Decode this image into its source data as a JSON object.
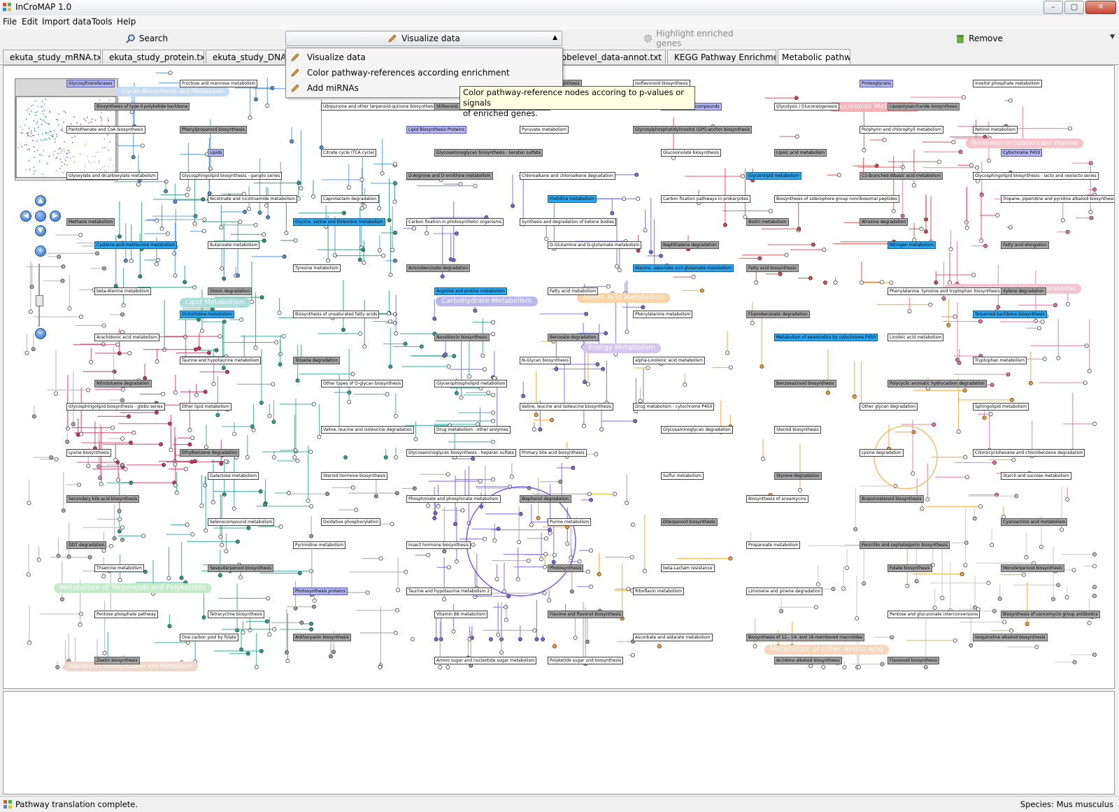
{
  "window": {
    "title": "InCroMAP 1.0",
    "min_glyph": "–",
    "max_glyph": "▢",
    "close_glyph": "✕"
  },
  "menu": {
    "items": [
      "File",
      "Edit",
      "Import data",
      "Tools",
      "Help"
    ]
  },
  "toolbar": {
    "search_label": "Search",
    "visualize_label": "Visualize data",
    "highlight_label": "Highlight enriched genes",
    "remove_label": "Remove"
  },
  "tabs": [
    "ekuta_study_mRNA.txt",
    "ekuta_study_protein.txt",
    "ekuta_study_DNA",
    "m_probelevel_data-annot.txt",
    "KEGG Pathway Enrichment",
    "Metabolic pathways"
  ],
  "dropdown": {
    "items": [
      "Visualize data",
      "Color pathway-references according enrichment",
      "Add miRNAs"
    ]
  },
  "tooltip": {
    "line1": "Color pathway-reference nodes accoring to p-values or signals",
    "line2": "of enriched genes."
  },
  "map": {
    "regions": [
      {
        "text": "Nucleotide Metabolism",
        "color": "#f7b0b8"
      },
      {
        "text": "Metabolism of Cofactors and Vitamins",
        "color": "#f7c4cc"
      },
      {
        "text": "Biosynthesis of Other Secondary Metabolites",
        "color": "#f3c4d0"
      },
      {
        "text": "Lipid Metabolism",
        "color": "#a9ddd8"
      },
      {
        "text": "Carbohydrate Metabolism",
        "color": "#b8b8ee"
      },
      {
        "text": "Amino Acid Metabolism",
        "color": "#f8d4a8"
      },
      {
        "text": "Energy Metabolism",
        "color": "#d4c4f0"
      },
      {
        "text": "Metabolism of Terpenoids and Polyketides",
        "color": "#c4ecc8"
      },
      {
        "text": "Metabolism of Other Amino Acid",
        "color": "#f8d4b8"
      },
      {
        "text": "Glycan Biosynthesis and Metabolism",
        "color": "#c4dcf4"
      },
      {
        "text": "Xenobiotics Biodegradation and Metabolism",
        "color": "#eed8cc"
      }
    ],
    "labels": [
      {
        "text": "Glycosyltransferases",
        "kind": "lav"
      },
      {
        "text": "Proteoglycans",
        "kind": "lav"
      },
      {
        "text": "Phytochemical compounds",
        "kind": "lav"
      },
      {
        "text": "Lipid Biosynthesis Proteins",
        "kind": "lav"
      },
      {
        "text": "Lipids",
        "kind": "lav"
      },
      {
        "text": "Cytochrome P450",
        "kind": "lav"
      },
      {
        "text": "Glycerolipid metabolism",
        "kind": "blue"
      },
      {
        "text": "Histidine metabolism",
        "kind": "blue"
      },
      {
        "text": "Glycine, serine and threonine metabolism",
        "kind": "blue"
      },
      {
        "text": "Cysteine and methionine metabolism",
        "kind": "blue"
      },
      {
        "text": "Nitrogen metabolism",
        "kind": "blue"
      },
      {
        "text": "Alanine, aspartate and glutamate metabolism",
        "kind": "blue"
      },
      {
        "text": "Arginine and proline metabolism",
        "kind": "blue"
      },
      {
        "text": "Glutathione metabolism",
        "kind": "blue"
      },
      {
        "text": "Terpenoid backbone biosynthesis",
        "kind": "blue"
      },
      {
        "text": "Metabolism of xenobiotics by cytochrome P450",
        "kind": "blue"
      },
      {
        "text": "N-Glycan biosynthesis",
        "kind": "white"
      },
      {
        "text": "Other types of O-glycan biosynthesis",
        "kind": "white"
      },
      {
        "text": "Glycosphingolipid biosynthesis - globo series",
        "kind": "white"
      },
      {
        "text": "Other glycan degradation",
        "kind": "white"
      },
      {
        "text": "Glycosaminoglycan degradation",
        "kind": "white"
      },
      {
        "text": "Glycosaminoglycan biosynthesis - heparan sulfate",
        "kind": "white"
      },
      {
        "text": "Galactose metabolism",
        "kind": "white"
      },
      {
        "text": "Starch and sucrose metabolism",
        "kind": "white"
      },
      {
        "text": "Biosynthesis of ansamycins",
        "kind": "white"
      },
      {
        "text": "Purine metabolism",
        "kind": "white"
      },
      {
        "text": "Pyrimidine metabolism",
        "kind": "white"
      },
      {
        "text": "Thiamine metabolism",
        "kind": "white"
      },
      {
        "text": "Folate biosynthesis",
        "kind": "gray"
      },
      {
        "text": "Riboflavin metabolism",
        "kind": "white"
      },
      {
        "text": "Vitamin B6 metabolism",
        "kind": "white"
      },
      {
        "text": "One carbon pool by folate",
        "kind": "white"
      },
      {
        "text": "Isoquinoline alkaloid biosynthesis",
        "kind": "gray"
      },
      {
        "text": "Acridone alkaloid biosynthesis",
        "kind": "gray"
      },
      {
        "text": "Indole alkaloid biosynthesis",
        "kind": "gray"
      },
      {
        "text": "Ubiquinone and other terpenoid-quinone biosynthesis",
        "kind": "white"
      },
      {
        "text": "Pantothenate and CoA biosynthesis",
        "kind": "white"
      },
      {
        "text": "Porphyrin and chlorophyll metabolism",
        "kind": "white"
      },
      {
        "text": "Glucosinolate biosynthesis",
        "kind": "white"
      },
      {
        "text": "D-Arginine and D-ornithine metabolism",
        "kind": "gray"
      },
      {
        "text": "Nicotinate and nicotinamide metabolism",
        "kind": "white"
      },
      {
        "text": "Tropane, piperidine and pyridine alkaloid biosynthesis",
        "kind": "white"
      },
      {
        "text": "Biotin metabolism",
        "kind": "gray"
      },
      {
        "text": "D-Glutamine and D-glutamate metabolism",
        "kind": "white"
      },
      {
        "text": "Tyrosine metabolism",
        "kind": "white"
      },
      {
        "text": "beta-Alanine metabolism",
        "kind": "white"
      },
      {
        "text": "Phenylalanine, tyrosine and tryptophan biosynthesis",
        "kind": "white"
      },
      {
        "text": "Phenylalanine metabolism",
        "kind": "white"
      },
      {
        "text": "Novobiocin biosynthesis",
        "kind": "gray"
      },
      {
        "text": "Taurine and hypotaurine metabolism",
        "kind": "white"
      },
      {
        "text": "Tryptophan metabolism",
        "kind": "white"
      },
      {
        "text": "Benzoxazinoid biosynthesis",
        "kind": "gray"
      },
      {
        "text": "Valine, leucine and isoleucine biosynthesis",
        "kind": "white"
      },
      {
        "text": "Valine, leucine and isoleucine degradation",
        "kind": "white"
      },
      {
        "text": "Lysine biosynthesis",
        "kind": "white"
      },
      {
        "text": "Lysine degradation",
        "kind": "white"
      },
      {
        "text": "Sulfur metabolism",
        "kind": "white"
      },
      {
        "text": "Phosphonate and phosphinate metabolism",
        "kind": "white"
      },
      {
        "text": "Selenocompound metabolism",
        "kind": "white"
      },
      {
        "text": "Cyanoamino acid metabolism",
        "kind": "gray"
      },
      {
        "text": "Propanoate metabolism",
        "kind": "white"
      },
      {
        "text": "Photosynthesis",
        "kind": "gray"
      },
      {
        "text": "Photosynthesis proteins",
        "kind": "lav"
      },
      {
        "text": "Pentose phosphate pathway",
        "kind": "white"
      },
      {
        "text": "Pentose and glucuronate interconversions",
        "kind": "white"
      },
      {
        "text": "Ascorbate and aldarate metabolism",
        "kind": "white"
      },
      {
        "text": "Amino sugar and nucleotide sugar metabolism",
        "kind": "white"
      },
      {
        "text": "Fructose and mannose metabolism",
        "kind": "white"
      },
      {
        "text": "Inositol phosphate metabolism",
        "kind": "white"
      },
      {
        "text": "Glycolysis / Gluconeogenesis",
        "kind": "white"
      },
      {
        "text": "Pyruvate metabolism",
        "kind": "white"
      },
      {
        "text": "Citrate cycle (TCA cycle)",
        "kind": "white"
      },
      {
        "text": "Glyoxylate and dicarboxylate metabolism",
        "kind": "white"
      },
      {
        "text": "C5-Branched dibasic acid metabolism",
        "kind": "gray"
      },
      {
        "text": "Carbon fixation pathways in prokaryotes",
        "kind": "white"
      },
      {
        "text": "Carbon fixation in photosynthetic organisms",
        "kind": "white"
      },
      {
        "text": "Butanoate metabolism",
        "kind": "white"
      },
      {
        "text": "Fatty acid elongation",
        "kind": "gray"
      },
      {
        "text": "Fatty acid biosynthesis",
        "kind": "gray"
      },
      {
        "text": "Fatty acid metabolism",
        "kind": "white"
      },
      {
        "text": "Biosynthesis of unsaturated fatty acids",
        "kind": "white"
      },
      {
        "text": "Arachidonic acid metabolism",
        "kind": "white"
      },
      {
        "text": "Linoleic acid metabolism",
        "kind": "white"
      },
      {
        "text": "alpha-Linolenic acid metabolism",
        "kind": "white"
      },
      {
        "text": "Glycerophospholipid metabolism",
        "kind": "white"
      },
      {
        "text": "Ether lipid metabolism",
        "kind": "white"
      },
      {
        "text": "Sphingolipid metabolism",
        "kind": "white"
      },
      {
        "text": "Steroid biosynthesis",
        "kind": "white"
      },
      {
        "text": "Primary bile acid biosynthesis",
        "kind": "white"
      },
      {
        "text": "Steroid hormone biosynthesis",
        "kind": "white"
      },
      {
        "text": "Secondary bile acid biosynthesis",
        "kind": "gray"
      },
      {
        "text": "Brassinosteroid biosynthesis",
        "kind": "gray"
      },
      {
        "text": "Diterpenoid biosynthesis",
        "kind": "gray"
      },
      {
        "text": "Insect hormone biosynthesis",
        "kind": "white"
      },
      {
        "text": "Sesquiterpenoid biosynthesis",
        "kind": "gray"
      },
      {
        "text": "Monoterpenoid biosynthesis",
        "kind": "gray"
      },
      {
        "text": "Limonene and pinene degradation",
        "kind": "white"
      },
      {
        "text": "Flavone and flavonol biosynthesis",
        "kind": "gray"
      },
      {
        "text": "Anthocyanin biosynthesis",
        "kind": "gray"
      },
      {
        "text": "Zeatin biosynthesis",
        "kind": "gray"
      },
      {
        "text": "Flavonoid biosynthesis",
        "kind": "gray"
      },
      {
        "text": "Isoflavonoid biosynthesis",
        "kind": "white"
      },
      {
        "text": "Stilbenoid, diarylheptanoid and gingerol biosynthesis",
        "kind": "gray"
      },
      {
        "text": "Phenylpropanoid biosynthesis",
        "kind": "gray"
      },
      {
        "text": "Retinol metabolism",
        "kind": "white"
      },
      {
        "text": "Lipoic acid metabolism",
        "kind": "gray"
      },
      {
        "text": "Chloroalkane and chloroalkene degradation",
        "kind": "white"
      },
      {
        "text": "Caprolactam degradation",
        "kind": "white"
      },
      {
        "text": "Methane metabolism",
        "kind": "gray"
      },
      {
        "text": "Atrazine degradation",
        "kind": "gray"
      },
      {
        "text": "Naphthalene degradation",
        "kind": "gray"
      },
      {
        "text": "Aminobenzoate degradation",
        "kind": "gray"
      },
      {
        "text": "Dioxin degradation",
        "kind": "gray"
      },
      {
        "text": "Xylene degradation",
        "kind": "gray"
      },
      {
        "text": "Fluorobenzoate degradation",
        "kind": "gray"
      },
      {
        "text": "Benzoate degradation",
        "kind": "gray"
      },
      {
        "text": "Toluene degradation",
        "kind": "gray"
      },
      {
        "text": "Nitrotoluene degradation",
        "kind": "gray"
      },
      {
        "text": "Polycyclic aromatic hydrocarbon degradation",
        "kind": "gray"
      },
      {
        "text": "Drug metabolism - cytochrome P450",
        "kind": "white"
      },
      {
        "text": "Drug metabolism - other enzymes",
        "kind": "white"
      },
      {
        "text": "Ethylbenzene degradation",
        "kind": "gray"
      },
      {
        "text": "Chlorocyclohexane and chlorobenzene degradation",
        "kind": "white"
      },
      {
        "text": "Styrene degradation",
        "kind": "gray"
      },
      {
        "text": "Bisphenol degradation",
        "kind": "gray"
      },
      {
        "text": "Oxidative phosphorylation",
        "kind": "white"
      },
      {
        "text": "DDT degradation",
        "kind": "gray"
      },
      {
        "text": "Penicillin and cephalosporin biosynthesis",
        "kind": "gray"
      },
      {
        "text": "beta-Lactam resistance",
        "kind": "white"
      },
      {
        "text": "Taurine and hypotaurine metabolism 2",
        "kind": "white"
      },
      {
        "text": "Tetracycline biosynthesis",
        "kind": "white"
      },
      {
        "text": "Biosynthesis of vancomycin group antibiotics",
        "kind": "gray"
      },
      {
        "text": "Biosynthesis of 12-, 14- and 16-membered macrolides",
        "kind": "gray"
      },
      {
        "text": "Polyketide sugar unit biosynthesis",
        "kind": "white"
      },
      {
        "text": "Biosynthesis of type II polyketide products",
        "kind": "gray"
      },
      {
        "text": "Biosynthesis of type II polyketide backbone",
        "kind": "gray"
      },
      {
        "text": "Lipopolysaccharide biosynthesis",
        "kind": "gray"
      },
      {
        "text": "Glycosylphosphatidylinositol (GPI)-anchor biosynthesis",
        "kind": "gray"
      },
      {
        "text": "Glycosaminoglycan biosynthesis - keratan sulfate",
        "kind": "gray"
      },
      {
        "text": "Glycosphingolipid biosynthesis - ganglio series",
        "kind": "white"
      },
      {
        "text": "Glycosphingolipid biosynthesis - lacto and neolacto series",
        "kind": "white"
      },
      {
        "text": "Biosynthesis of siderophore group nonribosomal peptides",
        "kind": "white"
      },
      {
        "text": "Synthesis and degradation of ketone bodies",
        "kind": "white"
      }
    ]
  },
  "status": {
    "left": "Pathway translation complete.",
    "right": "Species: Mus musculus"
  },
  "colors": {
    "accent": "#2aa7f0",
    "tooltip_bg": "#ffffe1",
    "canvas_bg": "#ffffff"
  }
}
